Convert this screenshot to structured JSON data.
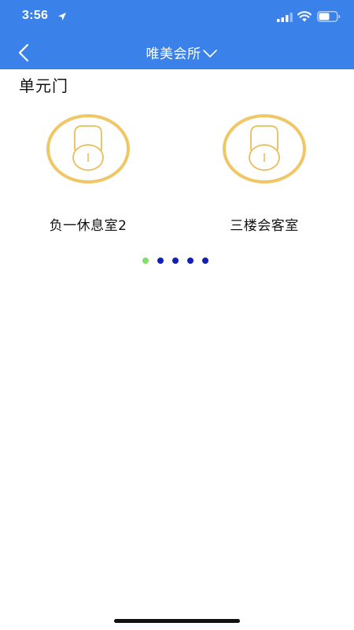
{
  "status_bar": {
    "time": "3:56",
    "icons": [
      "location-arrow-icon",
      "signal-icon",
      "wifi-icon",
      "battery-icon"
    ]
  },
  "navbar": {
    "back_icon": "back-chevron-icon",
    "title": "唯美会所",
    "dropdown_icon": "chevron-down-icon",
    "background_color": "#3a82ea"
  },
  "section": {
    "title": "单元门"
  },
  "locks": [
    {
      "label": "负一休息室2",
      "icon": "lock-icon"
    },
    {
      "label": "三楼会客室",
      "icon": "lock-icon"
    }
  ],
  "pager": {
    "page_count": 5,
    "current_page": 1,
    "active_color": "#7fe06a",
    "inactive_color": "#1320b8"
  },
  "colors": {
    "lock_ring": "#f0c766",
    "lock_line": "#e8be5c"
  }
}
